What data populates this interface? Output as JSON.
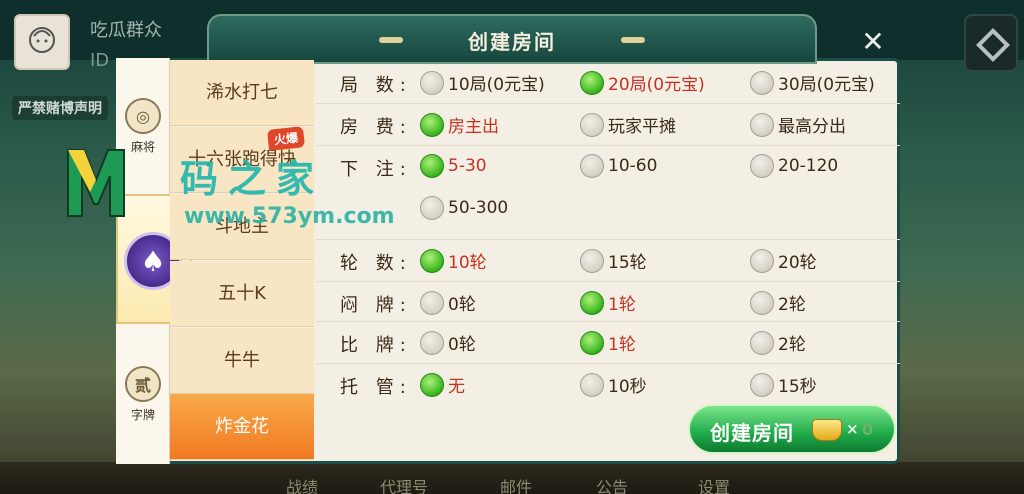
{
  "background": {
    "player_name": "吃瓜群众",
    "player_id": "ID",
    "notice": "严禁赌博声明",
    "bottom_nav": [
      "战绩",
      "代理号",
      "邮件",
      "公告",
      "设置"
    ]
  },
  "dialog": {
    "title": "创建房间",
    "close_icon": "close-icon"
  },
  "categories": [
    {
      "label": "麻将",
      "icon": "mahjong-icon"
    },
    {
      "label": "",
      "icon": "poker-chip-icon",
      "glyph": "♠"
    },
    {
      "label": "字牌",
      "icon": "zipai-icon",
      "glyph": "贰"
    }
  ],
  "games": [
    {
      "label": "浠水打七",
      "selected": false
    },
    {
      "label": "十六张跑得快",
      "selected": false,
      "badge": "火爆"
    },
    {
      "label": "斗地主",
      "selected": false
    },
    {
      "label": "五十K",
      "selected": false
    },
    {
      "label": "牛牛",
      "selected": false
    },
    {
      "label": "炸金花",
      "selected": true
    }
  ],
  "options": [
    {
      "label": "局 数:",
      "choices": [
        {
          "text": "10局(0元宝)",
          "on": false
        },
        {
          "text": "20局(0元宝)",
          "on": true
        },
        {
          "text": "30局(0元宝)",
          "on": false
        }
      ]
    },
    {
      "label": "房 费:",
      "choices": [
        {
          "text": "房主出",
          "on": true
        },
        {
          "text": "玩家平摊",
          "on": false
        },
        {
          "text": "最高分出",
          "on": false
        }
      ]
    },
    {
      "label": "下 注:",
      "choices": [
        {
          "text": "5-30",
          "on": true
        },
        {
          "text": "10-60",
          "on": false
        },
        {
          "text": "20-120",
          "on": false
        },
        {
          "text": "50-300",
          "on": false
        }
      ]
    },
    {
      "label": "轮 数:",
      "choices": [
        {
          "text": "10轮",
          "on": true
        },
        {
          "text": "15轮",
          "on": false
        },
        {
          "text": "20轮",
          "on": false
        }
      ]
    },
    {
      "label": "闷 牌:",
      "choices": [
        {
          "text": "0轮",
          "on": false
        },
        {
          "text": "1轮",
          "on": true
        },
        {
          "text": "2轮",
          "on": false
        }
      ]
    },
    {
      "label": "比 牌:",
      "choices": [
        {
          "text": "0轮",
          "on": false
        },
        {
          "text": "1轮",
          "on": true
        },
        {
          "text": "2轮",
          "on": false
        }
      ]
    },
    {
      "label": "托 管:",
      "choices": [
        {
          "text": "无",
          "on": true
        },
        {
          "text": "10秒",
          "on": false
        },
        {
          "text": "15秒",
          "on": false
        }
      ]
    }
  ],
  "create_button": {
    "label": "创建房间",
    "multiplier": "×",
    "cost": "0",
    "icon": "gold-ingot-icon"
  },
  "watermark": {
    "text": "码之家",
    "url": "www.573ym.com"
  },
  "colors": {
    "accent_green": "#37b51d",
    "selected_text": "#c43222",
    "selected_tab": "#f07a20",
    "title_bar": "#17473f"
  }
}
